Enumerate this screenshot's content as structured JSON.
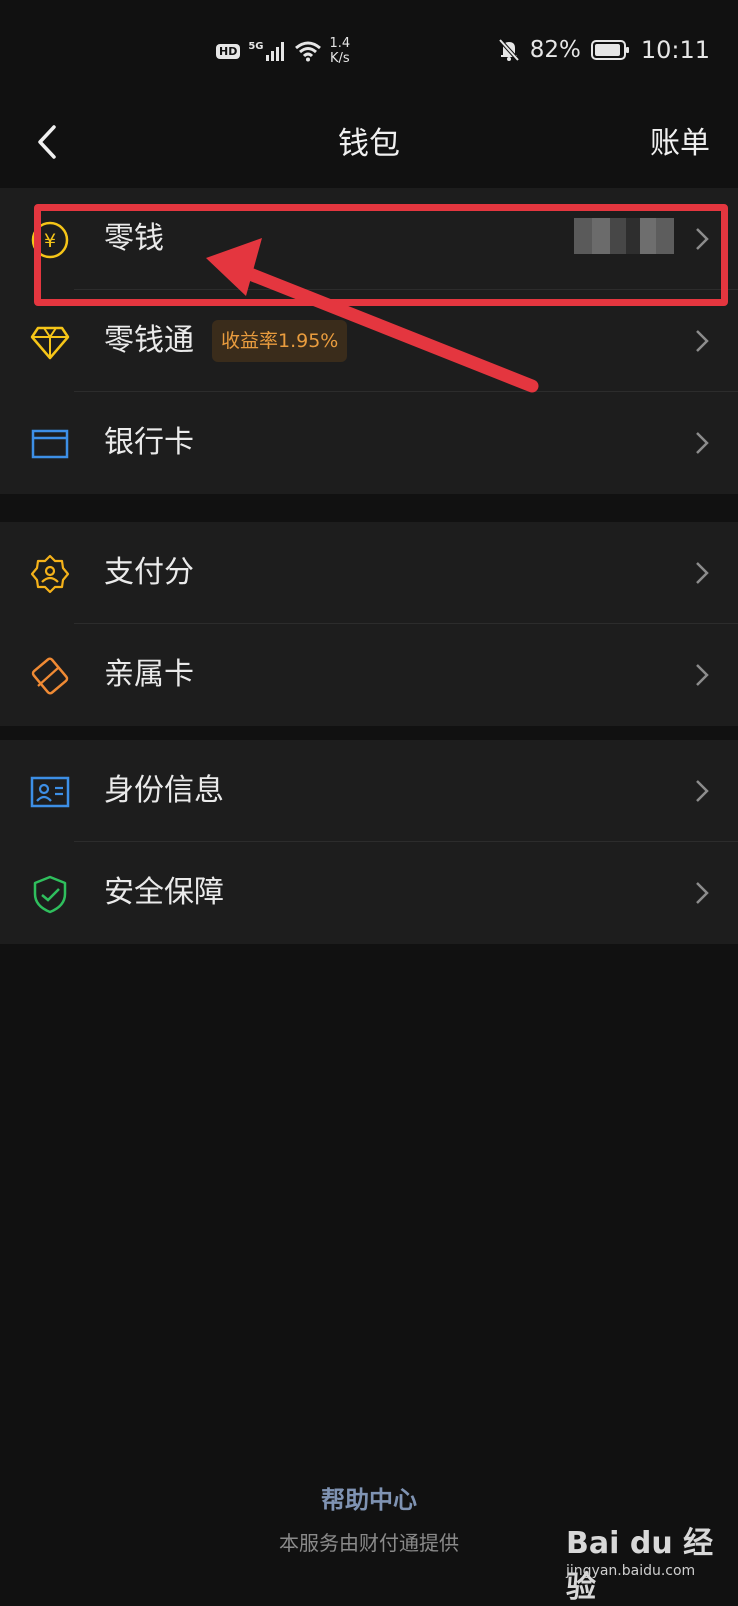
{
  "status_bar": {
    "hd": "HD",
    "network": "5G",
    "speed_value": "1.4",
    "speed_unit": "K/s",
    "battery": "82%",
    "time": "10:11"
  },
  "nav": {
    "title": "钱包",
    "bill": "账单"
  },
  "groups": [
    {
      "items": [
        {
          "label": "零钱",
          "icon": "yuan-coin-icon",
          "icon_color": "#f5c518"
        },
        {
          "label": "零钱通",
          "icon": "diamond-icon",
          "icon_color": "#f5c518",
          "badge": "收益率1.95%"
        },
        {
          "label": "银行卡",
          "icon": "bank-card-icon",
          "icon_color": "#3d8fe6"
        }
      ]
    },
    {
      "items": [
        {
          "label": "支付分",
          "icon": "credit-score-icon",
          "icon_color": "#f5b21a"
        },
        {
          "label": "亲属卡",
          "icon": "family-card-icon",
          "icon_color": "#ef8a34"
        }
      ]
    },
    {
      "items": [
        {
          "label": "身份信息",
          "icon": "id-card-icon",
          "icon_color": "#3d8fe6"
        },
        {
          "label": "安全保障",
          "icon": "shield-icon",
          "icon_color": "#2fbf5d"
        }
      ]
    }
  ],
  "footer": {
    "help": "帮助中心",
    "note": "本服务由财付通提供"
  },
  "watermark": {
    "logo": "Bai du 经验",
    "url": "jingyan.baidu.com"
  },
  "colors": {
    "background": "#111111",
    "row_background": "#1d1d1d",
    "annotation_red": "#e4363f",
    "badge_text": "#e99c3e"
  }
}
